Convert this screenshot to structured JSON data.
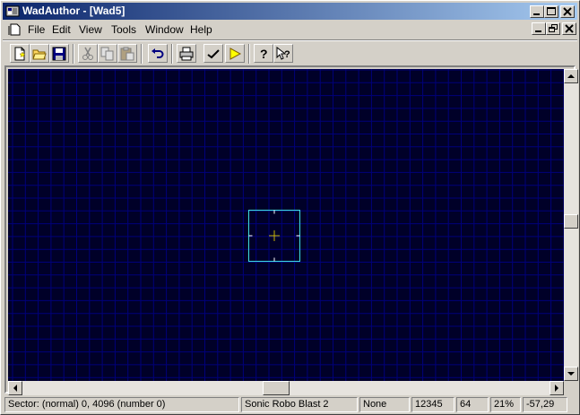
{
  "window": {
    "title": "WadAuthor - [Wad5]"
  },
  "menu": {
    "items": [
      {
        "label": "File"
      },
      {
        "label": "Edit"
      },
      {
        "label": "View"
      },
      {
        "label": "Tools"
      },
      {
        "label": "Window"
      },
      {
        "label": "Help"
      }
    ]
  },
  "toolbar": {
    "icons": [
      "new-document-icon",
      "open-folder-icon",
      "save-icon",
      "cut-icon",
      "copy-icon",
      "paste-icon",
      "undo-icon",
      "print-icon",
      "check-icon",
      "run-icon",
      "help-icon",
      "context-help-icon"
    ]
  },
  "map": {
    "background_color": "#000028",
    "grid_color": "#00007a",
    "sector_color": "#40e0e0",
    "crosshair_color": "#c8b400"
  },
  "status": {
    "sector": "Sector: (normal) 0, 4096 (number 0)",
    "game": "Sonic Robo Blast 2",
    "mode": "None",
    "value": "12345",
    "grid": "64",
    "zoom": "21%",
    "coords": "-57,29"
  }
}
